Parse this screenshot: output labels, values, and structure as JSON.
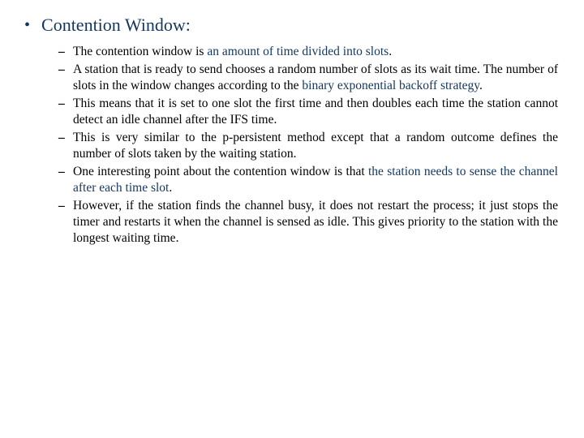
{
  "title": "Contention Window:",
  "bullets": [
    {
      "pre": "The contention window is ",
      "hl": "an amount of time divided into slots",
      "post": "."
    },
    {
      "pre": "A station that is ready to send chooses a random number of slots as its wait time. The number of slots in the window changes according to the ",
      "hl": "binary exponential backoff strategy",
      "post": "."
    },
    {
      "pre": "This means that it is set to one slot the first time and then doubles each time the station cannot detect an idle channel after the IFS time.",
      "hl": "",
      "post": ""
    },
    {
      "pre": "This is very similar to the p-persistent method except that a random outcome defines the number of slots taken by the waiting station.",
      "hl": "",
      "post": ""
    },
    {
      "pre": "One interesting point about the contention window is that ",
      "hl": "the station needs to sense the channel after each time slot",
      "post": "."
    },
    {
      "pre": "However, if the station finds the channel busy, it does not restart the process; it just stops the timer and restarts it when the channel is sensed as idle. This gives priority to the station with the longest waiting time.",
      "hl": "",
      "post": ""
    }
  ]
}
